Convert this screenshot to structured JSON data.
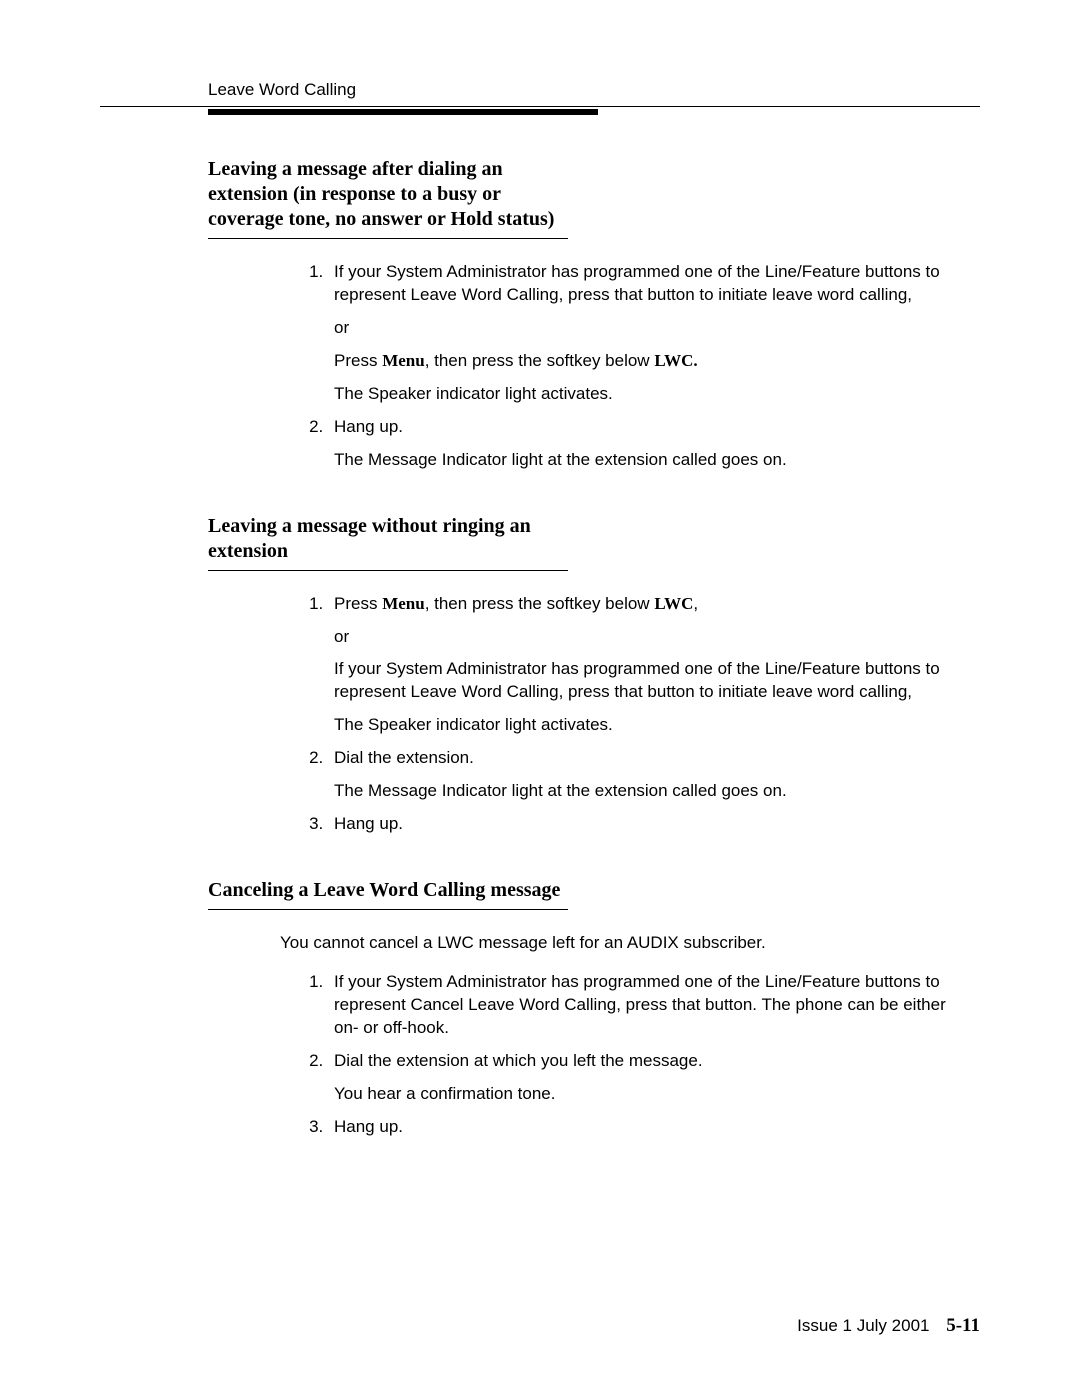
{
  "header": {
    "running_head": "Leave Word Calling"
  },
  "sections": [
    {
      "title": "Leaving a message after dialing an extension (in response to a busy or coverage tone, no answer or Hold status)",
      "intro": null,
      "steps": [
        {
          "main": "If your System Administrator has programmed one of the Line/Feature buttons to represent Leave Word Calling, press that button to initiate leave word calling,",
          "subs": [
            {
              "type": "plain",
              "text": "or"
            },
            {
              "type": "press_menu_lwc",
              "prefix": "Press ",
              "menu": "Menu",
              "mid": ", then press the softkey below ",
              "lwc": "LWC.",
              "suffix": ""
            },
            {
              "type": "plain",
              "text": "The Speaker indicator light activates."
            }
          ]
        },
        {
          "main": "Hang up.",
          "subs": [
            {
              "type": "plain",
              "text": "The Message Indicator light at the extension called goes on."
            }
          ]
        }
      ]
    },
    {
      "title": "Leaving a message without ringing an extension",
      "intro": null,
      "steps": [
        {
          "main_composite": {
            "prefix": "Press ",
            "menu": "Menu",
            "mid": ", then press the softkey below ",
            "lwc": "LWC",
            "suffix": ","
          },
          "subs": [
            {
              "type": "plain",
              "text": "or"
            },
            {
              "type": "plain",
              "text": "If your System Administrator has programmed one of the Line/Feature buttons to represent Leave Word Calling, press that button to initiate leave word calling,"
            },
            {
              "type": "plain",
              "text": "The Speaker indicator light activates."
            }
          ]
        },
        {
          "main": "Dial the extension.",
          "subs": [
            {
              "type": "plain",
              "text": "The Message Indicator light at the extension called goes on."
            }
          ]
        },
        {
          "main": "Hang up.",
          "subs": []
        }
      ]
    },
    {
      "title": "Canceling a Leave Word Calling message",
      "intro": "You cannot cancel a LWC message left for an AUDIX subscriber.",
      "steps": [
        {
          "main": "If your System Administrator has programmed one of the Line/Feature buttons to represent Cancel Leave Word Calling, press that button. The phone can be either on- or off-hook.",
          "subs": []
        },
        {
          "main": "Dial the extension at which you left the message.",
          "subs": [
            {
              "type": "plain",
              "text": "You hear a confirmation tone."
            }
          ]
        },
        {
          "main": "Hang up.",
          "subs": []
        }
      ]
    }
  ],
  "footer": {
    "issue": "Issue  1   July 2001",
    "page": "5-11"
  }
}
